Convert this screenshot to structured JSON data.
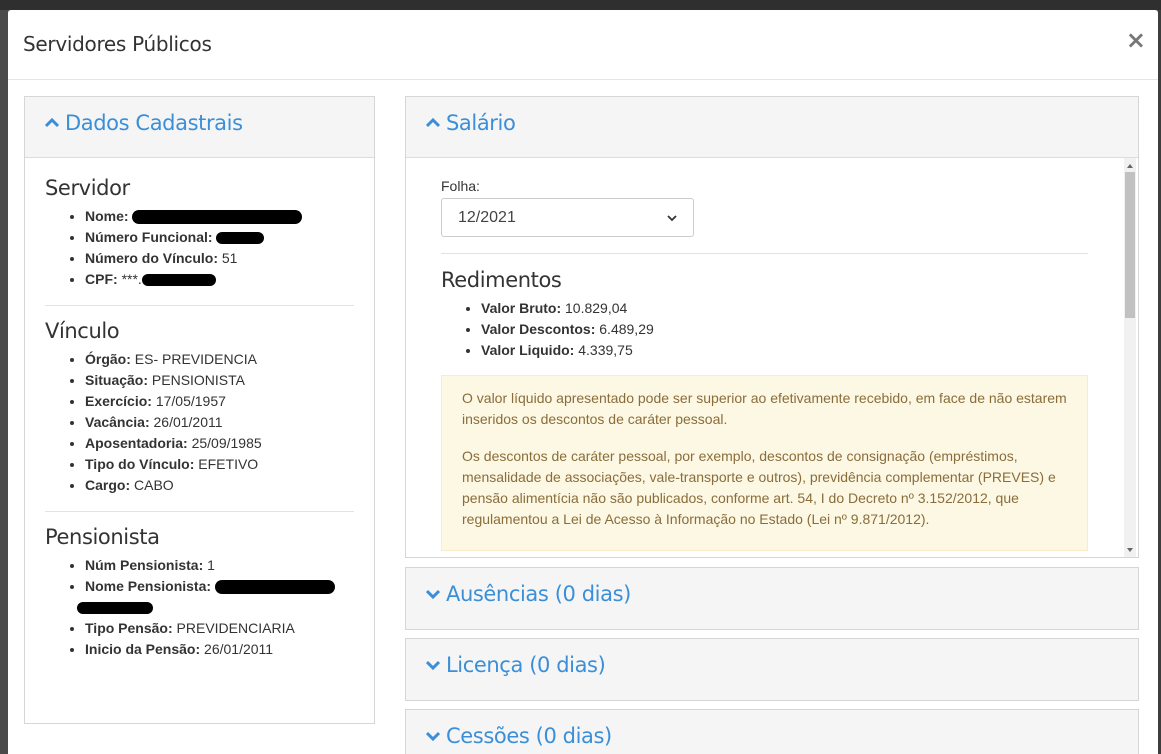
{
  "modal": {
    "title": "Servidores Públicos",
    "close_label": "×"
  },
  "dados_cadastrais": {
    "heading": "Dados Cadastrais",
    "servidor": {
      "title": "Servidor",
      "nome_label": "Nome:",
      "numero_funcional_label": "Número Funcional:",
      "numero_vinculo_label": "Número do Vínculo:",
      "numero_vinculo_value": "51",
      "cpf_label": "CPF:",
      "cpf_value": "***."
    },
    "vinculo": {
      "title": "Vínculo",
      "items": [
        {
          "label": "Órgão:",
          "value": "ES- PREVIDENCIA"
        },
        {
          "label": "Situação:",
          "value": "PENSIONISTA"
        },
        {
          "label": "Exercício:",
          "value": "17/05/1957"
        },
        {
          "label": "Vacância:",
          "value": "26/01/2011"
        },
        {
          "label": "Aposentadoria:",
          "value": "25/09/1985"
        },
        {
          "label": "Tipo do Vínculo:",
          "value": "EFETIVO"
        },
        {
          "label": "Cargo:",
          "value": "CABO"
        }
      ]
    },
    "pensionista": {
      "title": "Pensionista",
      "num_label": "Núm Pensionista:",
      "num_value": "1",
      "nome_label": "Nome Pensionista:",
      "tipo_label": "Tipo Pensão:",
      "tipo_value": "PREVIDENCIARIA",
      "inicio_label": "Inicio da Pensão:",
      "inicio_value": "26/01/2011"
    }
  },
  "salario": {
    "heading": "Salário",
    "folha_label": "Folha:",
    "folha_selected": "12/2021",
    "redimentos_title": "Redimentos",
    "items": [
      {
        "label": "Valor Bruto:",
        "value": "10.829,04"
      },
      {
        "label": "Valor Descontos:",
        "value": "6.489,29"
      },
      {
        "label": "Valor Liquido:",
        "value": "4.339,75"
      }
    ],
    "alert_p1": "O valor líquido apresentado pode ser superior ao efetivamente recebido, em face de não estarem inseridos os descontos de caráter pessoal.",
    "alert_p2": "Os descontos de caráter pessoal, por exemplo, descontos de consignação (empréstimos, mensalidade de associações, vale-transporte e outros), previdência complementar (PREVES) e pensão alimentícia não são publicados, conforme art. 54, I do Decreto nº 3.152/2012, que regulamentou a Lei de Acesso à Informação no Estado (Lei nº 9.871/2012)."
  },
  "ausencias": {
    "heading": "Ausências (0 dias)"
  },
  "licenca": {
    "heading": "Licença (0 dias)"
  },
  "cessoes": {
    "heading": "Cessões (0 dias)"
  },
  "colors": {
    "accent": "#3a8fd8",
    "alert_bg": "#fcf8e3",
    "alert_text": "#8a6d3b"
  },
  "icons": {
    "expanded": "chevron-up-icon",
    "collapsed": "chevron-down-icon",
    "close": "close-icon"
  }
}
